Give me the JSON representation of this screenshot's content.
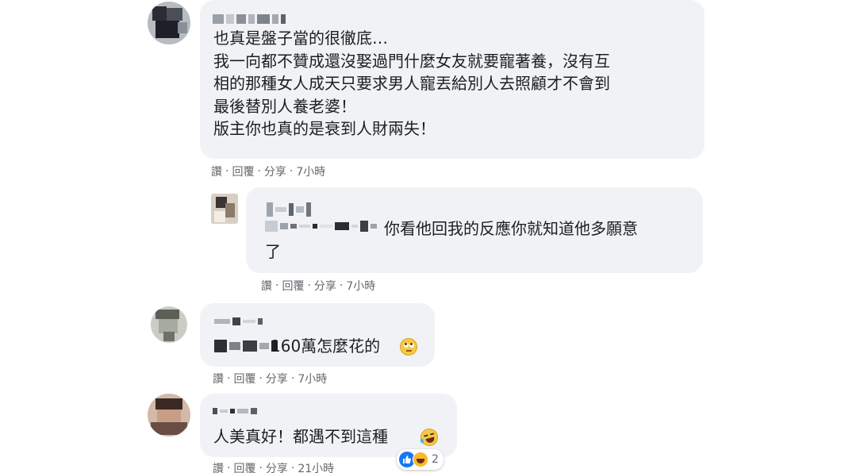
{
  "actions": {
    "like": "讚",
    "reply": "回覆",
    "share": "分享",
    "sep": "·"
  },
  "comments": [
    {
      "text": "也真是盤子當的很徹底…\n我一向都不贊成還沒娶過門什麼女友就要寵著養，沒有互\n相的那種女人成天只要求男人寵丟給別人去照顧才不會到\n最後替別人養老婆！\n版主你也真的是衰到人財兩失！",
      "time": "7小時"
    },
    {
      "text": "你看他回我的反應你就知道他多願意\n了",
      "time": "7小時"
    },
    {
      "text": "160萬怎麼花的",
      "time": "7小時",
      "emoji": "rolling-eyes-emoji"
    },
    {
      "text": "人美真好！都遇不到這種",
      "time": "21小時",
      "emoji": "laughing-tears-emoji",
      "reactions": {
        "icons": [
          "like-reaction-icon",
          "haha-reaction-icon"
        ],
        "count": "2"
      }
    }
  ],
  "colors": {
    "bubble": "#f0f2f5",
    "like_blue": "#1877f2",
    "haha_yellow": "#f7b928",
    "meta_gray": "#65676b"
  }
}
